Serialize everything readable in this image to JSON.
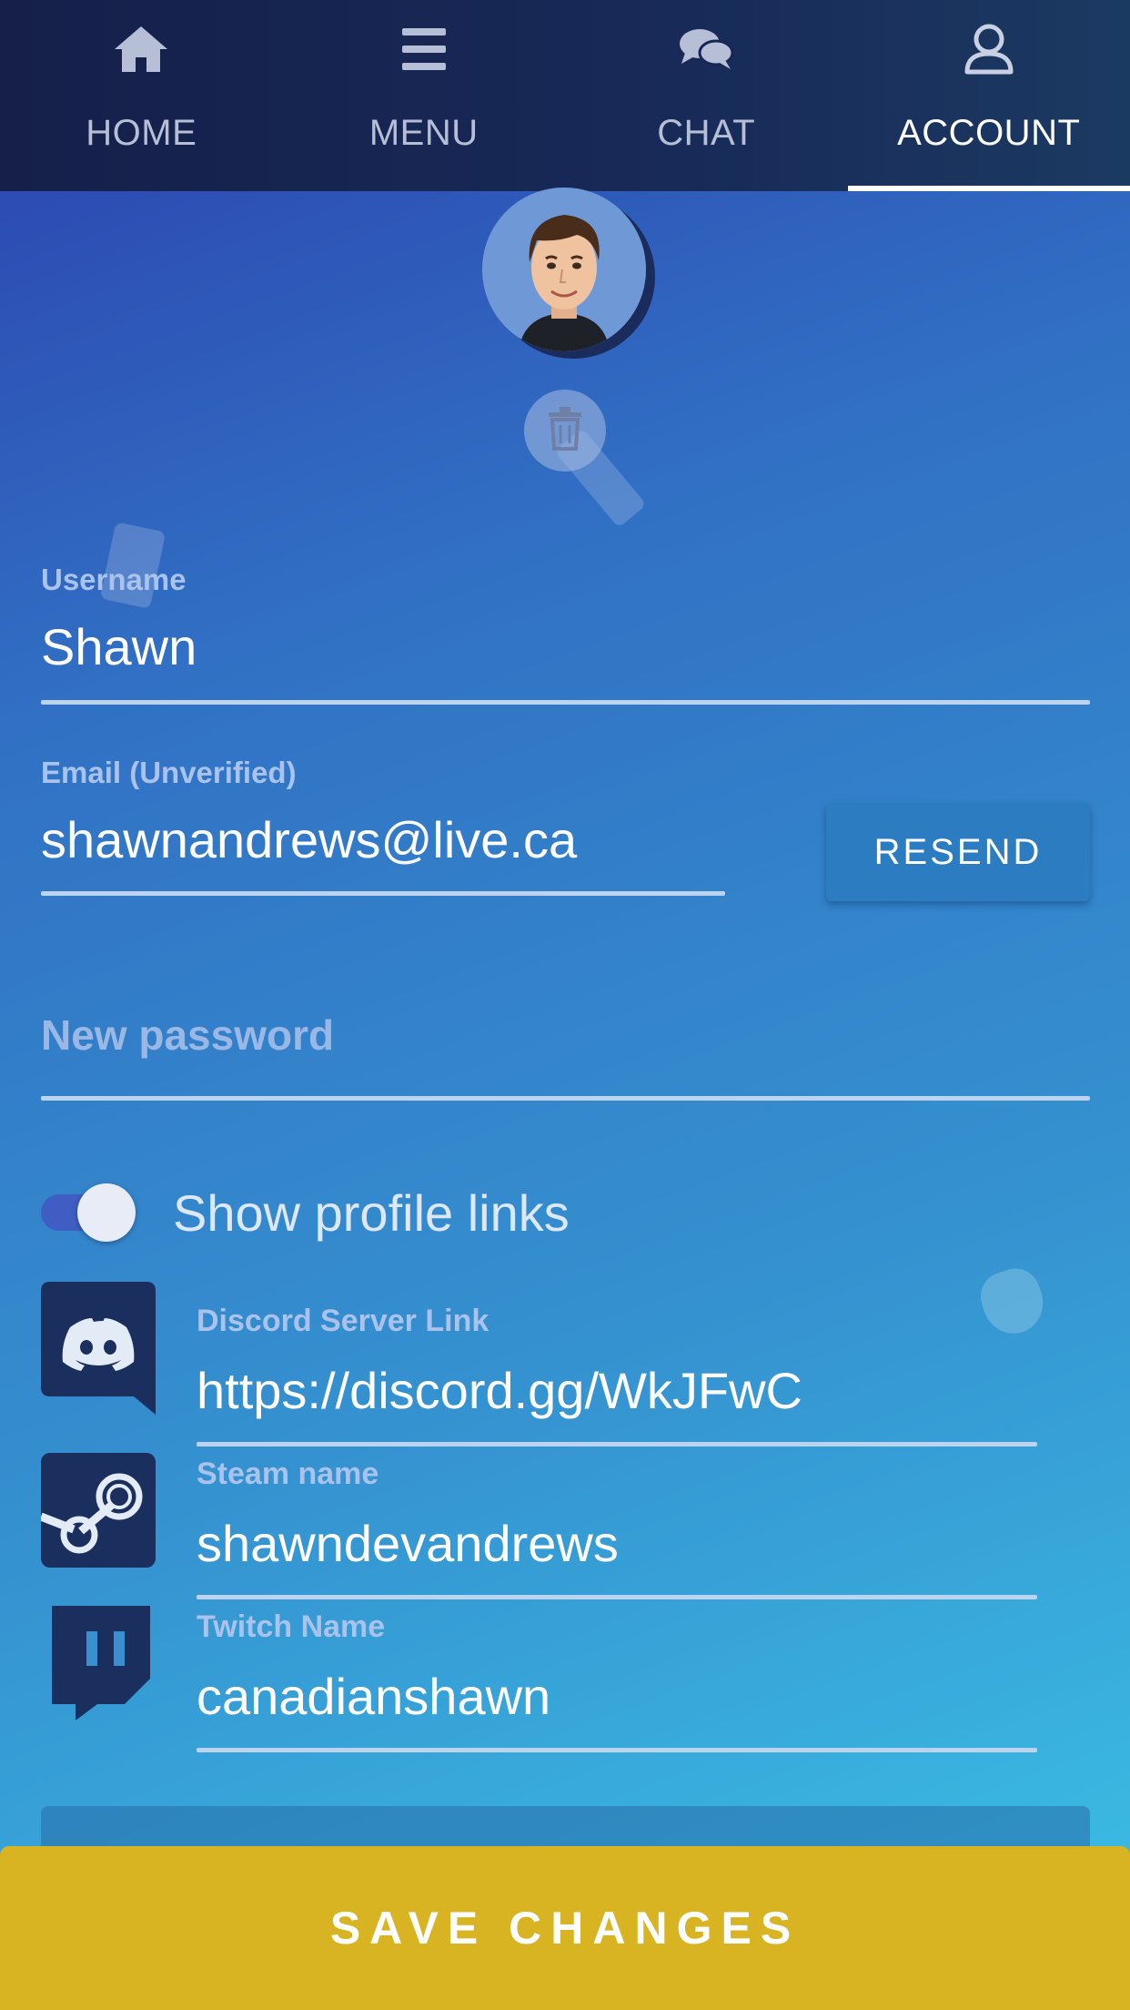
{
  "nav": {
    "tabs": [
      {
        "label": "HOME",
        "icon": "home-icon"
      },
      {
        "label": "MENU",
        "icon": "menu-icon"
      },
      {
        "label": "CHAT",
        "icon": "chat-icon"
      },
      {
        "label": "ACCOUNT",
        "icon": "user-icon",
        "active": true
      }
    ]
  },
  "profile": {
    "avatar_icon": "avatar-portrait",
    "delete_icon": "trash-icon"
  },
  "form": {
    "username": {
      "label": "Username",
      "value": "Shawn"
    },
    "email": {
      "label": "Email (Unverified)",
      "value": "shawnandrews@live.ca"
    },
    "resend_label": "RESEND",
    "password": {
      "placeholder": "New password",
      "value": ""
    },
    "show_links": {
      "label": "Show profile links",
      "checked": true
    }
  },
  "links": {
    "discord": {
      "label": "Discord Server Link",
      "value": "https://discord.gg/WkJFwC",
      "icon": "discord-icon"
    },
    "steam": {
      "label": "Steam name",
      "value": "shawndevandrews",
      "icon": "steam-icon"
    },
    "twitch": {
      "label": "Twitch Name",
      "value": "canadianshawn",
      "icon": "twitch-icon"
    }
  },
  "actions": {
    "save_label": "SAVE CHANGES"
  },
  "colors": {
    "header_bg": "#151f4a",
    "save_button": "#d9b422",
    "resend_button": "#2b7cc0",
    "icon_dark": "#1b2f5e"
  }
}
